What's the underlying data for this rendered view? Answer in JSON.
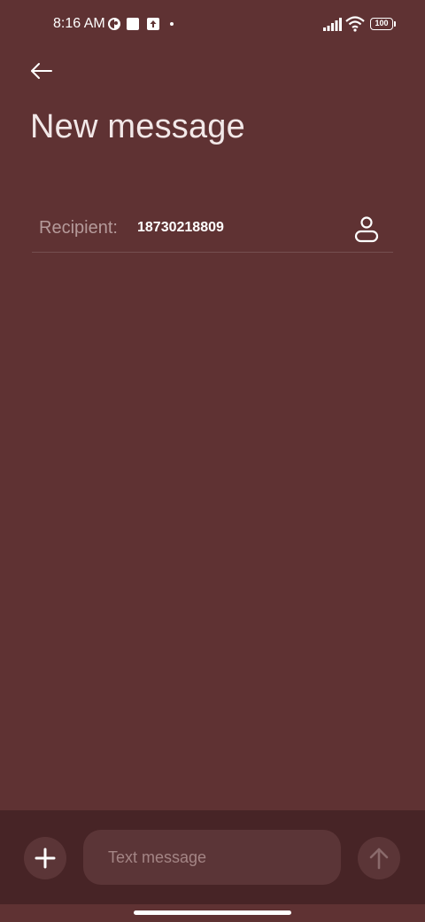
{
  "status_bar": {
    "time": "8:16 AM",
    "battery_level": "100",
    "icons": [
      "vpn-icon",
      "square-notification-icon",
      "upload-icon",
      "signal-icon",
      "wifi-icon",
      "battery-icon"
    ]
  },
  "header": {
    "title": "New message",
    "back_icon": "arrow-left-icon"
  },
  "recipient": {
    "label": "Recipient:",
    "value": "18730218809",
    "contact_icon": "person-icon"
  },
  "compose": {
    "placeholder": "Text message",
    "add_icon": "plus-icon",
    "send_icon": "arrow-up-icon"
  },
  "colors": {
    "background": "#5f3233",
    "compose_bar": "#472426",
    "control": "#5b3537",
    "label": "#b59a9a"
  }
}
